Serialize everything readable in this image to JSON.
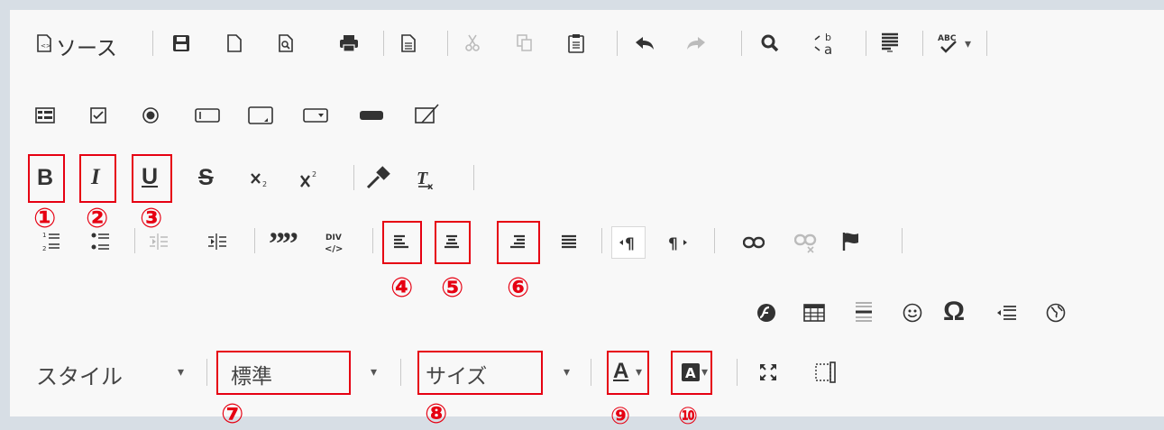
{
  "row1": {
    "source_label": "ソース",
    "icons": [
      "source-icon",
      "save-icon",
      "new-page-icon",
      "preview-icon",
      "print-icon",
      "templates-icon",
      "cut-icon",
      "copy-icon",
      "paste-icon",
      "undo-icon",
      "redo-icon",
      "find-icon",
      "replace-icon",
      "select-all-icon",
      "spellcheck-icon"
    ]
  },
  "row2": {
    "icons": [
      "form-icon",
      "checkbox-icon",
      "radio-icon",
      "textfield-icon",
      "textarea-icon",
      "select-icon",
      "button-icon",
      "hidden-field-icon"
    ]
  },
  "row3": {
    "icons": [
      "bold-icon",
      "italic-icon",
      "underline-icon",
      "strike-icon",
      "subscript-icon",
      "superscript-icon",
      "copy-format-icon",
      "remove-format-icon"
    ],
    "bold_glyph": "B",
    "italic_glyph": "I",
    "underline_glyph": "U",
    "strike_glyph": "S"
  },
  "row4": {
    "icons": [
      "numbered-list-icon",
      "bulleted-list-icon",
      "outdent-icon",
      "indent-icon",
      "blockquote-icon",
      "div-container-icon",
      "align-left-icon",
      "align-center-icon",
      "align-right-icon",
      "justify-icon",
      "ltr-icon",
      "rtl-icon",
      "link-icon",
      "unlink-icon",
      "anchor-icon"
    ],
    "quote_glyph": "””",
    "div_glyph": "DIV"
  },
  "row5": {
    "icons": [
      "flash-icon",
      "table-icon",
      "horizontal-rule-icon",
      "smiley-icon",
      "special-char-icon",
      "page-break-icon",
      "iframe-icon"
    ],
    "omega": "Ω"
  },
  "row6": {
    "style_label": "スタイル",
    "format_label": "標準",
    "size_label": "サイズ",
    "text_color_glyph": "A",
    "bg_color_glyph": "A",
    "caret": "▾",
    "icons": [
      "maximize-icon",
      "show-blocks-icon"
    ]
  },
  "annotations": [
    "①",
    "②",
    "③",
    "④",
    "⑤",
    "⑥",
    "⑦",
    "⑧",
    "⑨",
    "⑩"
  ],
  "colors": {
    "annotation": "#e60012",
    "toolbar_bg": "#f8f8f8",
    "page_bg": "#d7dee5",
    "icon": "#333333"
  }
}
